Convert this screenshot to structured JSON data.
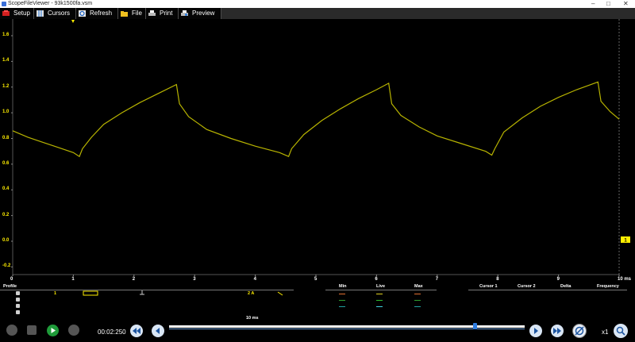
{
  "window": {
    "title": "ScopeFileViewer - 93k1500fa.vsm"
  },
  "toolbar": {
    "setup": "Setup",
    "cursors": "Cursors",
    "refresh": "Refresh",
    "file": "File",
    "print": "Print",
    "preview": "Preview"
  },
  "chart_data": {
    "type": "line",
    "xlabel": "",
    "ylabel": "",
    "x_ticks": [
      "0",
      "1",
      "2",
      "3",
      "4",
      "5",
      "6",
      "7",
      "8",
      "9",
      "10 ms"
    ],
    "y_ticks": [
      "1.6",
      "1.4",
      "1.2",
      "1.0",
      "0.8",
      "0.6",
      "0.4",
      "0.2",
      "0.0",
      "-0.2"
    ],
    "xlim": [
      0,
      10
    ],
    "ylim": [
      -0.3,
      1.75
    ],
    "grid": false,
    "color": "#b8b400",
    "channel_marker": "1",
    "series": [
      {
        "x": [
          0,
          0.25,
          0.5,
          0.75,
          1.0,
          1.1,
          1.15,
          1.3,
          1.5,
          1.8,
          2.1,
          2.4,
          2.7,
          2.75,
          2.9,
          3.2,
          3.6,
          4.0,
          4.4,
          4.55,
          4.6,
          4.8,
          5.1,
          5.4,
          5.7,
          6.0,
          6.2,
          6.25,
          6.4,
          6.7,
          7.0,
          7.4,
          7.8,
          7.9,
          7.95,
          8.1,
          8.4,
          8.7,
          9.0,
          9.3,
          9.65,
          9.7,
          9.85,
          10.0
        ],
        "y": [
          0.86,
          0.81,
          0.77,
          0.73,
          0.69,
          0.66,
          0.72,
          0.81,
          0.91,
          1.0,
          1.08,
          1.15,
          1.22,
          1.07,
          0.97,
          0.87,
          0.8,
          0.74,
          0.69,
          0.66,
          0.72,
          0.83,
          0.94,
          1.03,
          1.11,
          1.18,
          1.23,
          1.07,
          0.98,
          0.89,
          0.82,
          0.76,
          0.7,
          0.67,
          0.72,
          0.85,
          0.96,
          1.05,
          1.12,
          1.18,
          1.24,
          1.09,
          1.01,
          0.95
        ]
      }
    ]
  },
  "table": {
    "headers": {
      "profile": "Profile",
      "min": "Min",
      "live": "Live",
      "max": "Max",
      "cursor1": "Cursor 1",
      "cursor2": "Cursor 2",
      "delta": "Delta",
      "frequency": "Frequency"
    },
    "row1": {
      "channel": "1",
      "range": "2 A"
    },
    "timebase": "10 ms"
  },
  "controls": {
    "time": "00:02:250",
    "zoom": "x1",
    "playback_position": 0.86
  }
}
